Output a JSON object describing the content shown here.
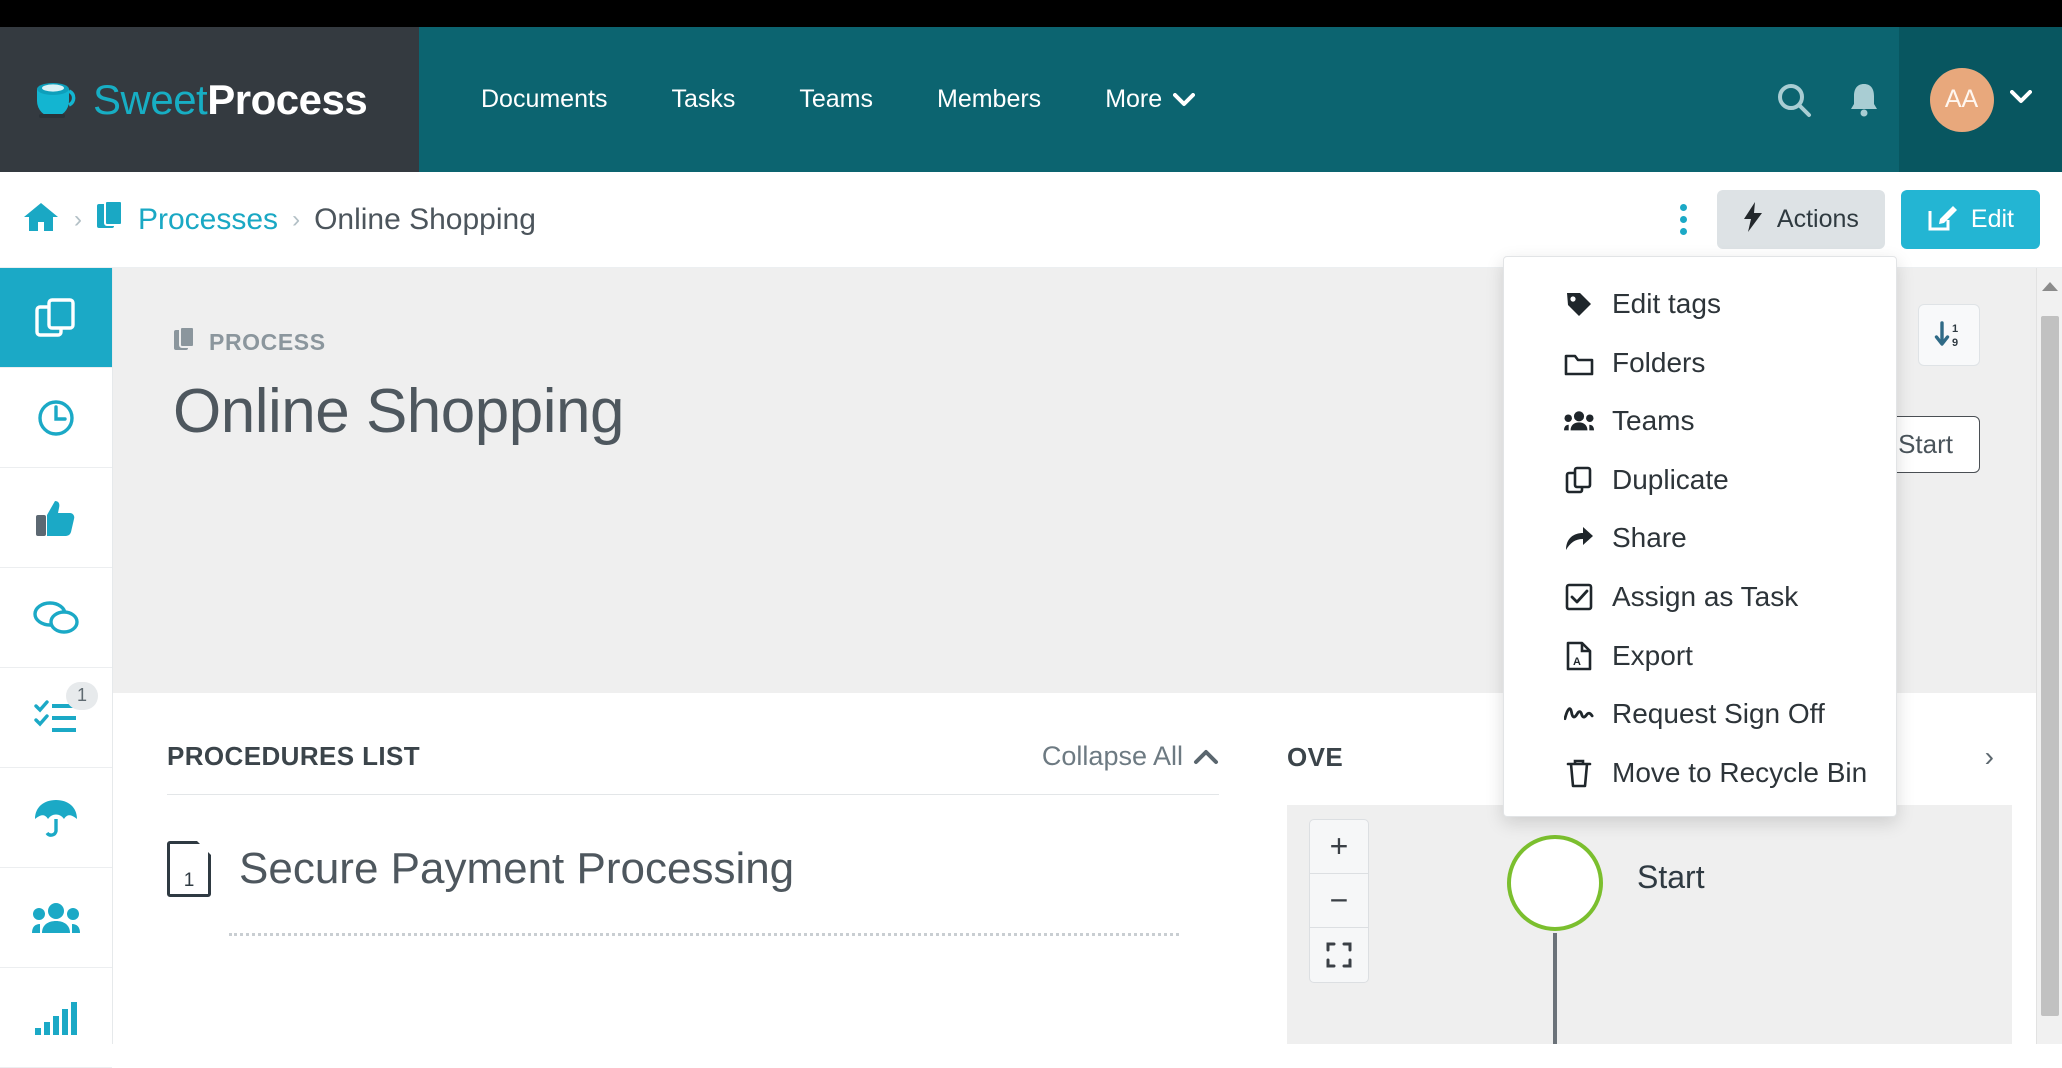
{
  "brand": {
    "name_light": "Sweet",
    "name_bold": "Process",
    "logo_icon": "coffee-cup-icon",
    "teal": "#0c6470",
    "dark": "#343a40",
    "cyan": "#1ba9c6",
    "accent_edit": "#23b5d3",
    "avatar_bg": "#e8a87c"
  },
  "header": {
    "nav_items": [
      {
        "label": "Documents"
      },
      {
        "label": "Tasks"
      },
      {
        "label": "Teams"
      },
      {
        "label": "Members"
      },
      {
        "label": "More"
      }
    ],
    "more_caret": "⌄",
    "search_icon": "search-icon",
    "bell_icon": "bell-icon",
    "avatar_initials": "AA",
    "avatar_caret": "⌄"
  },
  "breadcrumb": {
    "home_icon": "home-icon",
    "sep": "›",
    "processes_label": "Processes",
    "processes_icon": "documents-icon",
    "current_label": "Online Shopping",
    "kebab_icon": "vertical-dots-icon",
    "actions_label": "Actions",
    "actions_icon": "lightning-bolt-icon",
    "edit_label": "Edit",
    "edit_icon": "pencil-square-icon"
  },
  "actions_menu": {
    "items": [
      {
        "label": "Edit tags",
        "icon": "tag-icon"
      },
      {
        "label": "Folders",
        "icon": "folder-icon"
      },
      {
        "label": "Teams",
        "icon": "users-icon"
      },
      {
        "label": "Duplicate",
        "icon": "copy-icon"
      },
      {
        "label": "Share",
        "icon": "share-arrow-icon"
      },
      {
        "label": "Assign as Task",
        "icon": "checkbox-icon"
      },
      {
        "label": "Export",
        "icon": "pdf-file-icon"
      },
      {
        "label": "Request Sign Off",
        "icon": "signature-icon"
      },
      {
        "label": "Move to Recycle Bin",
        "icon": "trash-icon"
      }
    ]
  },
  "sidebar": {
    "items": [
      {
        "name": "documents",
        "icon": "copy-documents-icon",
        "active": true,
        "badge": ""
      },
      {
        "name": "history",
        "icon": "clock-icon",
        "active": false,
        "badge": ""
      },
      {
        "name": "approvals",
        "icon": "thumbs-up-icon",
        "active": false,
        "badge": ""
      },
      {
        "name": "comments",
        "icon": "comments-icon",
        "active": false,
        "badge": ""
      },
      {
        "name": "tasks",
        "icon": "checklist-icon",
        "active": false,
        "badge": "1"
      },
      {
        "name": "policies",
        "icon": "umbrella-icon",
        "active": false,
        "badge": ""
      },
      {
        "name": "teams",
        "icon": "people-group-icon",
        "active": false,
        "badge": ""
      },
      {
        "name": "reports",
        "icon": "bar-chart-icon",
        "active": false,
        "badge": ""
      }
    ]
  },
  "hero": {
    "kicker": "PROCESS",
    "kicker_icon": "documents-icon",
    "title": "Online Shopping",
    "sort_icon": "sort-numeric-down-icon",
    "start_label": "Start",
    "start_icon": "play-icon"
  },
  "procedures_panel": {
    "title": "PROCEDURES LIST",
    "collapse_label": "Collapse All",
    "collapse_caret": "⌃",
    "items": [
      {
        "number": "1",
        "name": "Secure Payment Processing",
        "icon": "document-number-icon"
      }
    ]
  },
  "overview_panel": {
    "title": "OVE",
    "chevron": "›",
    "flow": {
      "zoom_in": "+",
      "zoom_out": "−",
      "fullscreen_icon": "fullscreen-icon",
      "start_node_label": "Start",
      "start_node_color": "#7bbf2e"
    }
  },
  "scrollbar": {
    "up_arrow_icon": "caret-up-icon"
  }
}
